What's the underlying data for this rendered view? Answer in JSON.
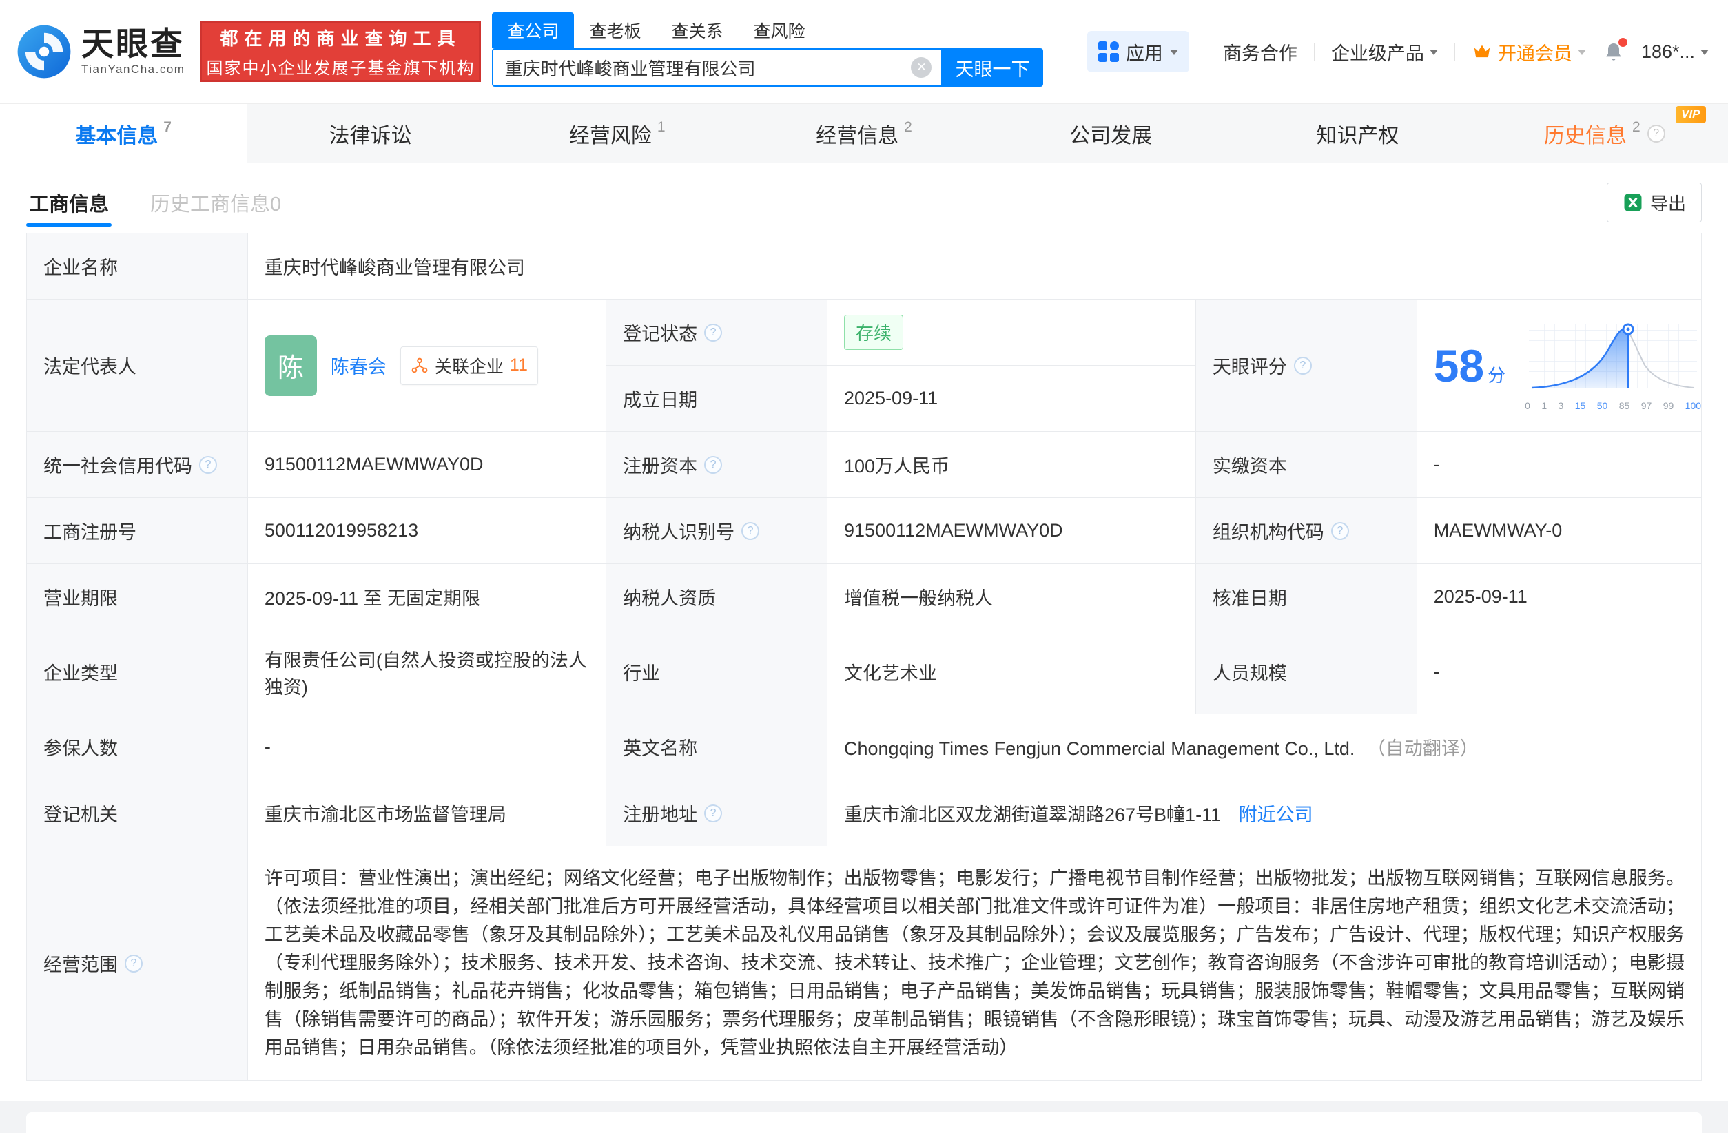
{
  "colors": {
    "brand_blue": "#0084ff",
    "banner_red": "#e23f38",
    "vip_orange": "#ff8a00",
    "history_tab_orange": "#ff7a30",
    "status_green": "#3cb26b",
    "score_blue": "#2f7df7",
    "avatar_green": "#74c3a0"
  },
  "header": {
    "logo": {
      "brand": "天眼查",
      "site": "TianYanCha.com"
    },
    "banner": {
      "line1": "都在用的商业查询工具",
      "line2": "国家中小企业发展子基金旗下机构"
    },
    "search": {
      "tabs": [
        {
          "label": "查公司",
          "active": true
        },
        {
          "label": "查老板",
          "active": false
        },
        {
          "label": "查关系",
          "active": false
        },
        {
          "label": "查风险",
          "active": false
        }
      ],
      "value": "重庆时代峰峻商业管理有限公司",
      "button": "天眼一下"
    },
    "nav": {
      "apps": "应用",
      "coop": "商务合作",
      "enterprise": "企业级产品",
      "vip": "开通会员",
      "account": "186*..."
    }
  },
  "company_tabs": [
    {
      "label": "基本信息",
      "count": "7"
    },
    {
      "label": "法律诉讼",
      "count": ""
    },
    {
      "label": "经营风险",
      "count": "1"
    },
    {
      "label": "经营信息",
      "count": "2"
    },
    {
      "label": "公司发展",
      "count": ""
    },
    {
      "label": "知识产权",
      "count": ""
    },
    {
      "label": "历史信息",
      "count": "2",
      "vip_badge": "VIP"
    }
  ],
  "toolbar": {
    "subtab_active": "工商信息",
    "subtab_history": "历史工商信息0",
    "export_label": "导出"
  },
  "fields": {
    "company_name": {
      "label": "企业名称",
      "value": "重庆时代峰峻商业管理有限公司"
    },
    "legal_rep": {
      "label": "法定代表人",
      "avatar": "陈",
      "name": "陈春会",
      "related_label": "关联企业",
      "related_count": "11"
    },
    "reg_status": {
      "label": "登记状态",
      "value": "存续"
    },
    "est_date": {
      "label": "成立日期",
      "value": "2025-09-11"
    },
    "score": {
      "label": "天眼评分",
      "value": "58",
      "unit": "分",
      "ticks": [
        "0",
        "1",
        "3",
        "15",
        "50",
        "85",
        "97",
        "99",
        "100"
      ]
    },
    "credit_code": {
      "label": "统一社会信用代码",
      "value": "91500112MAEWMWAY0D"
    },
    "reg_capital": {
      "label": "注册资本",
      "value": "100万人民币"
    },
    "paid_capital": {
      "label": "实缴资本",
      "value": "-"
    },
    "reg_number": {
      "label": "工商注册号",
      "value": "500112019958213"
    },
    "taxpayer_id": {
      "label": "纳税人识别号",
      "value": "91500112MAEWMWAY0D"
    },
    "org_code": {
      "label": "组织机构代码",
      "value": "MAEWMWAY-0"
    },
    "business_term": {
      "label": "营业期限",
      "value": "2025-09-11 至 无固定期限"
    },
    "taxpayer_quality": {
      "label": "纳税人资质",
      "value": "增值税一般纳税人"
    },
    "approval_date": {
      "label": "核准日期",
      "value": "2025-09-11"
    },
    "company_type": {
      "label": "企业类型",
      "value": "有限责任公司(自然人投资或控股的法人独资)"
    },
    "industry": {
      "label": "行业",
      "value": "文化艺术业"
    },
    "staff_size": {
      "label": "人员规模",
      "value": "-"
    },
    "insured_count": {
      "label": "参保人数",
      "value": "-"
    },
    "english_name": {
      "label": "英文名称",
      "value": "Chongqing Times Fengjun Commercial Management Co., Ltd.",
      "note": "（自动翻译）"
    },
    "reg_authority": {
      "label": "登记机关",
      "value": "重庆市渝北区市场监督管理局"
    },
    "reg_address": {
      "label": "注册地址",
      "value": "重庆市渝北区双龙湖街道翠湖路267号B幢1-11",
      "link": "附近公司"
    },
    "business_scope": {
      "label": "经营范围",
      "value": "许可项目：营业性演出；演出经纪；网络文化经营；电子出版物制作；出版物零售；电影发行；广播电视节目制作经营；出版物批发；出版物互联网销售；互联网信息服务。（依法须经批准的项目，经相关部门批准后方可开展经营活动，具体经营项目以相关部门批准文件或许可证件为准）一般项目：非居住房地产租赁；组织文化艺术交流活动；工艺美术品及收藏品零售（象牙及其制品除外）；工艺美术品及礼仪用品销售（象牙及其制品除外）；会议及展览服务；广告发布；广告设计、代理；版权代理；知识产权服务（专利代理服务除外）；技术服务、技术开发、技术咨询、技术交流、技术转让、技术推广；企业管理；文艺创作；教育咨询服务（不含涉许可审批的教育培训活动）；电影摄制服务；纸制品销售；礼品花卉销售；化妆品零售；箱包销售；日用品销售；电子产品销售；美发饰品销售；玩具销售；服装服饰零售；鞋帽零售；文具用品零售；互联网销售（除销售需要许可的商品）；软件开发；游乐园服务；票务代理服务；皮革制品销售；眼镜销售（不含隐形眼镜）；珠宝首饰零售；玩具、动漫及游艺用品销售；游艺及娱乐用品销售；日用杂品销售。（除依法须经批准的项目外，凭营业执照依法自主开展经营活动）"
    }
  }
}
